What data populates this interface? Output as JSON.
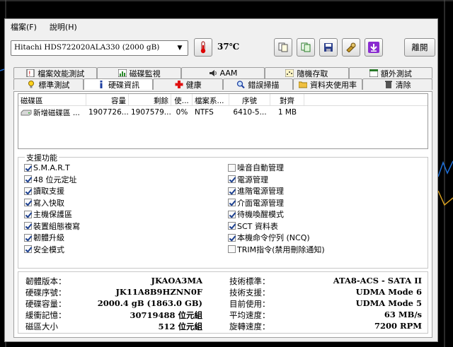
{
  "menu": {
    "file": "檔案(F)",
    "help": "說明(H)"
  },
  "toolbar": {
    "drive": "Hitachi HDS722020ALA330 (2000 gB)",
    "temperature": "37℃",
    "exit_label": "離開"
  },
  "tabs": {
    "row1": [
      "檔案效能測試",
      "磁碟監視",
      "AAM",
      "隨機存取",
      "額外測試"
    ],
    "row2": [
      "標準測試",
      "硬碟資訊",
      "健康",
      "錯誤掃描",
      "資料夾使用率",
      "清除"
    ],
    "active": "硬碟資訊"
  },
  "partitions": {
    "headers": [
      "磁碟區",
      "容量",
      "剩餘",
      "使...",
      "檔案系...",
      "序號",
      "對齊"
    ],
    "rows": [
      [
        "新增磁碟區 ...",
        "1907726...",
        "1907579...",
        "0%",
        "NTFS",
        "6410-5...",
        "1 MB"
      ]
    ]
  },
  "features": {
    "title": "支援功能",
    "left": [
      {
        "label": "S.M.A.R.T",
        "checked": true
      },
      {
        "label": "48 位元定址",
        "checked": true
      },
      {
        "label": "讀取支援",
        "checked": true
      },
      {
        "label": "寫入快取",
        "checked": true
      },
      {
        "label": "主機保護區",
        "checked": true
      },
      {
        "label": "裝置組態複寫",
        "checked": true
      },
      {
        "label": "韌體升級",
        "checked": true
      },
      {
        "label": "安全模式",
        "checked": true
      }
    ],
    "right": [
      {
        "label": "噪音自動管理",
        "checked": false
      },
      {
        "label": "電源管理",
        "checked": true
      },
      {
        "label": "進階電源管理",
        "checked": true
      },
      {
        "label": "介面電源管理",
        "checked": true
      },
      {
        "label": "待機喚醒模式",
        "checked": true
      },
      {
        "label": "SCT 資料表",
        "checked": true
      },
      {
        "label": "本機命令佇列 (NCQ)",
        "checked": true
      },
      {
        "label": "TRIM指令(禁用刪除通知)",
        "checked": false
      }
    ]
  },
  "info": {
    "left": [
      {
        "label": "韌體版本：",
        "value": "JKAOA3MA"
      },
      {
        "label": "硬碟序號：",
        "value": "JK11A8B9HZNN0F"
      },
      {
        "label": "硬碟容量：",
        "value": "2000.4 gB (1863.0 GB)"
      },
      {
        "label": "緩衝記憶：",
        "value": "30719488 位元組"
      },
      {
        "label": "磁區大小",
        "value": "512 位元組"
      }
    ],
    "right": [
      {
        "label": "技術標準：",
        "value": "ATA8-ACS - SATA II"
      },
      {
        "label": "技術支援：",
        "value": "UDMA Mode 6"
      },
      {
        "label": "目前使用：",
        "value": "UDMA Mode 5"
      },
      {
        "label": "平均速度：",
        "value": "63 MB/s"
      },
      {
        "label": "旋轉速度：",
        "value": "7200 RPM"
      }
    ]
  }
}
